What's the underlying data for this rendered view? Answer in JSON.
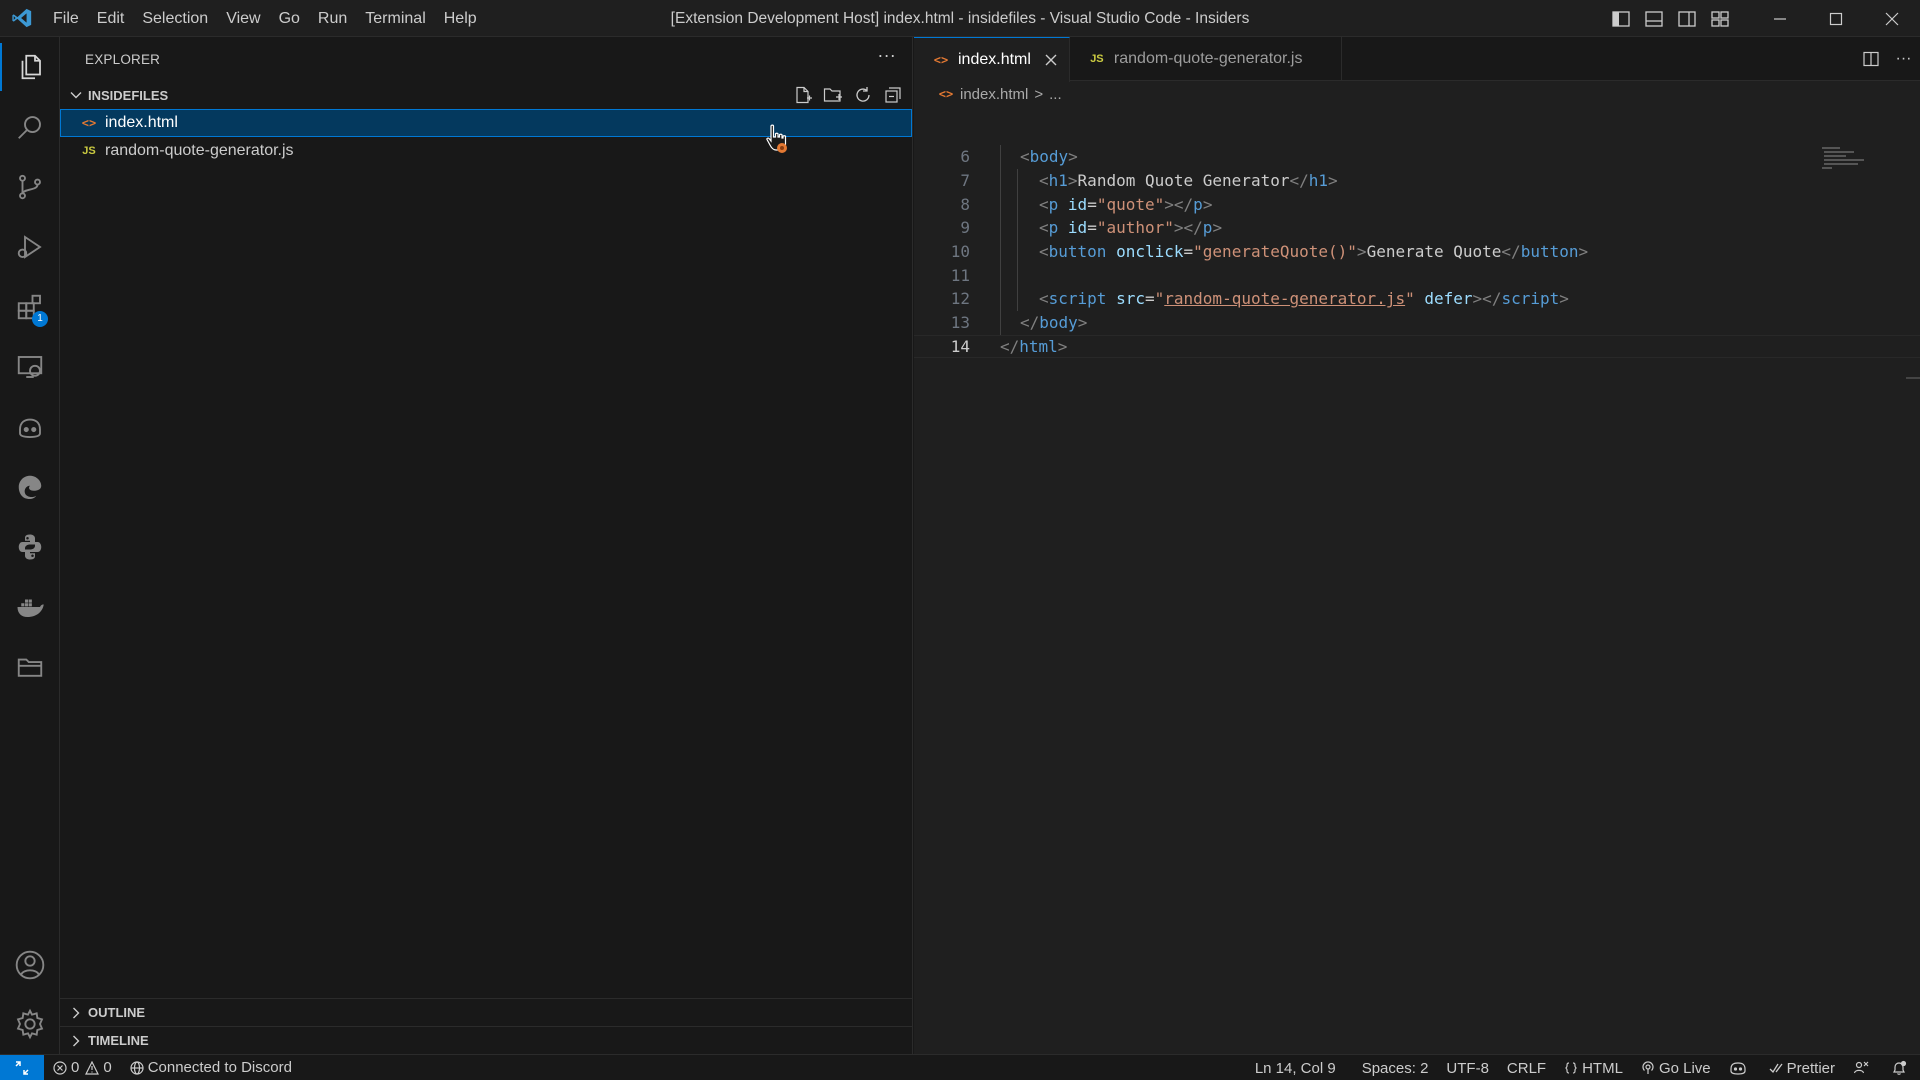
{
  "titlebar": {
    "menu": [
      "File",
      "Edit",
      "Selection",
      "View",
      "Go",
      "Run",
      "Terminal",
      "Help"
    ],
    "title": "[Extension Development Host] index.html - insidefiles - Visual Studio Code - Insiders"
  },
  "activitybar": {
    "items": [
      "explorer-icon",
      "search-icon",
      "source-control-icon",
      "run-debug-icon",
      "extensions-icon",
      "remote-explorer-icon",
      "copilot-icon",
      "edge-icon",
      "python-icon",
      "docker-icon",
      "folder-icon"
    ],
    "extensions_badge": "1",
    "bottom": [
      "account-icon",
      "settings-gear-icon"
    ]
  },
  "sidebar": {
    "header": "EXPLORER",
    "more": "···",
    "folder": "INSIDEFILES",
    "files": [
      {
        "icon": "<>",
        "name": "index.html",
        "selected": true
      },
      {
        "icon": "JS",
        "name": "random-quote-generator.js",
        "selected": false
      }
    ],
    "outline": "OUTLINE",
    "timeline": "TIMELINE"
  },
  "editor": {
    "tabs": [
      {
        "icon": "<>",
        "label": "index.html",
        "active": true
      },
      {
        "icon": "JS",
        "label": "random-quote-generator.js",
        "active": false
      }
    ],
    "breadcrumb": {
      "icon": "<>",
      "file": "index.html",
      "sep": ">",
      "rest": "..."
    },
    "line_numbers": [
      "6",
      "7",
      "8",
      "9",
      "10",
      "11",
      "12",
      "13",
      "14"
    ],
    "code": {
      "l6_tag": "body",
      "l7_tag": "h1",
      "l7_text": "Random Quote Generator",
      "l7_close": "h1",
      "l8_tag": "p",
      "l8_attr": "id",
      "l8_val": "\"quote\"",
      "l8_close": "p",
      "l9_tag": "p",
      "l9_attr": "id",
      "l9_val": "\"author\"",
      "l9_close": "p",
      "l10_tag": "button",
      "l10_attr": "onclick",
      "l10_val": "\"generateQuote()\"",
      "l10_text": "Generate Quote",
      "l10_close": "button",
      "l12_tag": "script",
      "l12_attr": "src",
      "l12_val": "random-quote-generator.js",
      "l12_attr2": "defer",
      "l12_close": "script",
      "l13_close": "body",
      "l14_close": "html"
    }
  },
  "statusbar": {
    "errors": "0",
    "warnings": "0",
    "discord": "Connected to Discord",
    "position": "Ln 14, Col 9",
    "spaces": "Spaces: 2",
    "encoding": "UTF-8",
    "eol": "CRLF",
    "language": "HTML",
    "golive": "Go Live",
    "prettier": "Prettier"
  },
  "colors": {
    "accent": "#0078d4",
    "background": "#181818",
    "editor_bg": "#1f1f1f",
    "selection": "#04395e"
  }
}
